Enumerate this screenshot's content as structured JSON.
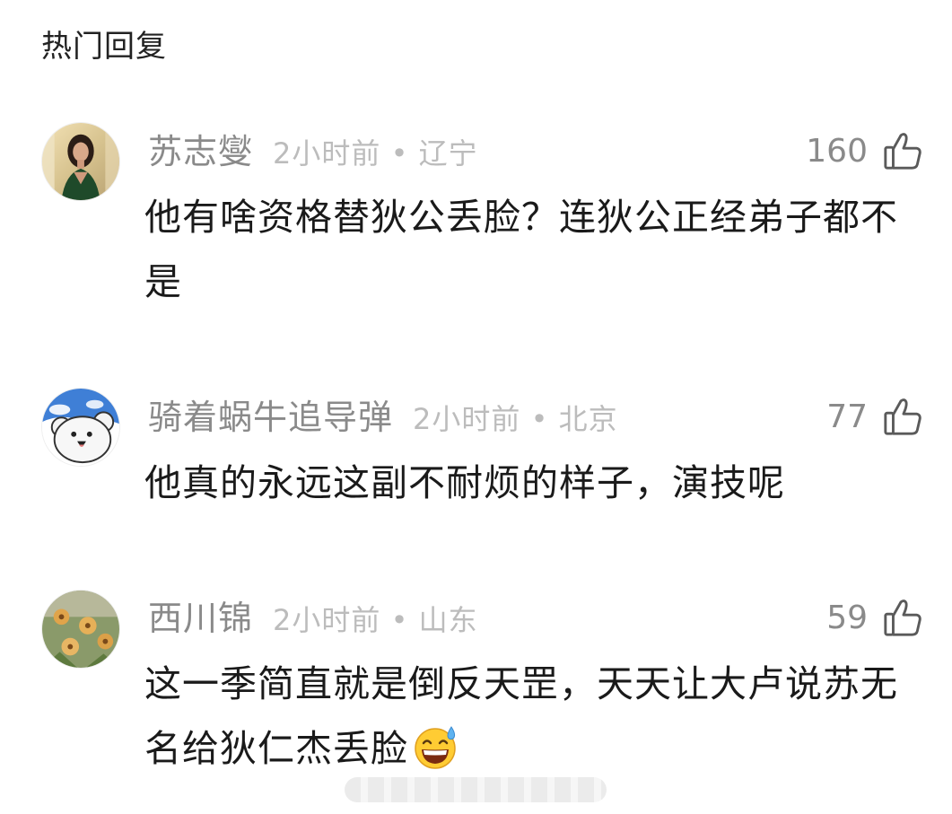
{
  "section_title": "热门回复",
  "comments": [
    {
      "username": "苏志燮",
      "time": "2小时前",
      "location": "辽宁",
      "likes": "160",
      "text": "他有啥资格替狄公丢脸？连狄公正经弟子都不是",
      "avatar_icon": "woman-portrait-avatar"
    },
    {
      "username": "骑着蜗牛追导弹",
      "time": "2小时前",
      "location": "北京",
      "likes": "77",
      "text": "他真的永远这副不耐烦的样子，演技呢",
      "avatar_icon": "cartoon-bear-avatar"
    },
    {
      "username": "西川锦",
      "time": "2小时前",
      "location": "山东",
      "likes": "59",
      "text": "这一季简直就是倒反天罡，天天让大卢说苏无名给狄仁杰丢脸",
      "emoji_icon": "grinning-sweat-emoji",
      "avatar_icon": "flowers-avatar"
    }
  ],
  "separator": "•",
  "colors": {
    "username": "#8a8a8a",
    "meta": "#bcbcbc",
    "text": "#1a1a1a",
    "background": "#ffffff"
  },
  "icons": {
    "like": "thumbs-up-icon"
  }
}
